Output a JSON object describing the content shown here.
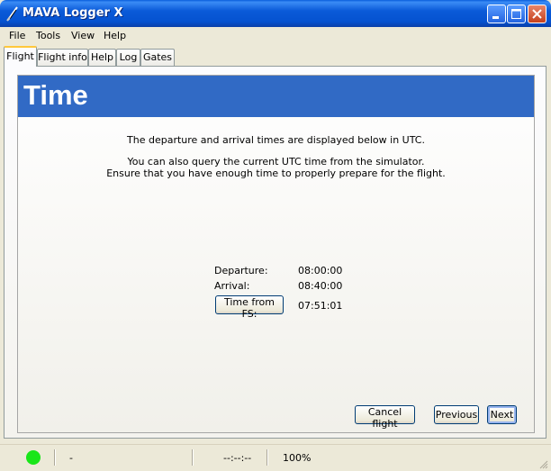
{
  "window": {
    "title": "MAVA Logger X"
  },
  "titlebar_buttons": {
    "minimize_icon": "minimize-icon",
    "maximize_icon": "maximize-icon",
    "close_icon": "close-icon"
  },
  "menu": [
    "File",
    "Tools",
    "View",
    "Help"
  ],
  "tabs": [
    {
      "label": "Flight",
      "active": true
    },
    {
      "label": "Flight info",
      "active": false
    },
    {
      "label": "Help",
      "active": false
    },
    {
      "label": "Log",
      "active": false
    },
    {
      "label": "Gates",
      "active": false
    }
  ],
  "page": {
    "title": "Time",
    "line1": "The departure and arrival times are displayed below in UTC.",
    "line2": "You can also query the current UTC time from the simulator.",
    "line3": "Ensure that you have enough time to properly prepare for the flight."
  },
  "times": {
    "departure_label": "Departure:",
    "departure_value": "08:00:00",
    "arrival_label": "Arrival:",
    "arrival_value": "08:40:00",
    "fs_button": "Time from FS:",
    "fs_value": "07:51:01"
  },
  "buttons": {
    "cancel": "Cancel flight",
    "previous": "Previous",
    "next": "Next"
  },
  "status": {
    "connection_color": "#19e619",
    "field1": "-",
    "field2": "--:--:--",
    "field3": "100%"
  },
  "colors": {
    "banner": "#316ac5",
    "titlebar": "#0a5ad8"
  }
}
